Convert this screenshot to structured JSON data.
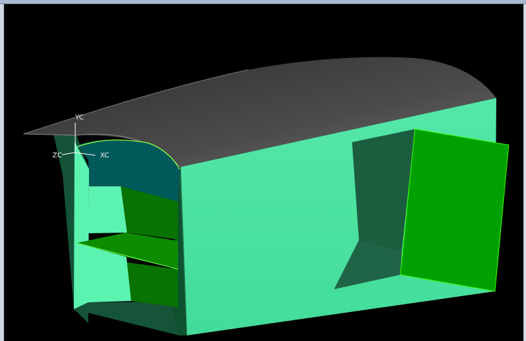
{
  "window": {
    "title": ""
  },
  "viewport": {
    "background_color": "#000000",
    "axes": {
      "y_label": "YC",
      "x_label": "XC",
      "z_label": "ZC"
    }
  },
  "model": {
    "type": "3d-shaded-enclosure",
    "colors": {
      "roof": "#4a4a4a",
      "roof_highlight": "#707070",
      "side_wall": "#45e2a1",
      "side_wall_highlight": "#57f1b0",
      "inner_back": "#004f50",
      "inner_wall": "#0f5b2a",
      "inner_green": "#087700",
      "shelf": "#0c8a00",
      "door": "#05a000",
      "door_edge": "#26ff00",
      "opening_dark": "#1b5b3c"
    }
  }
}
